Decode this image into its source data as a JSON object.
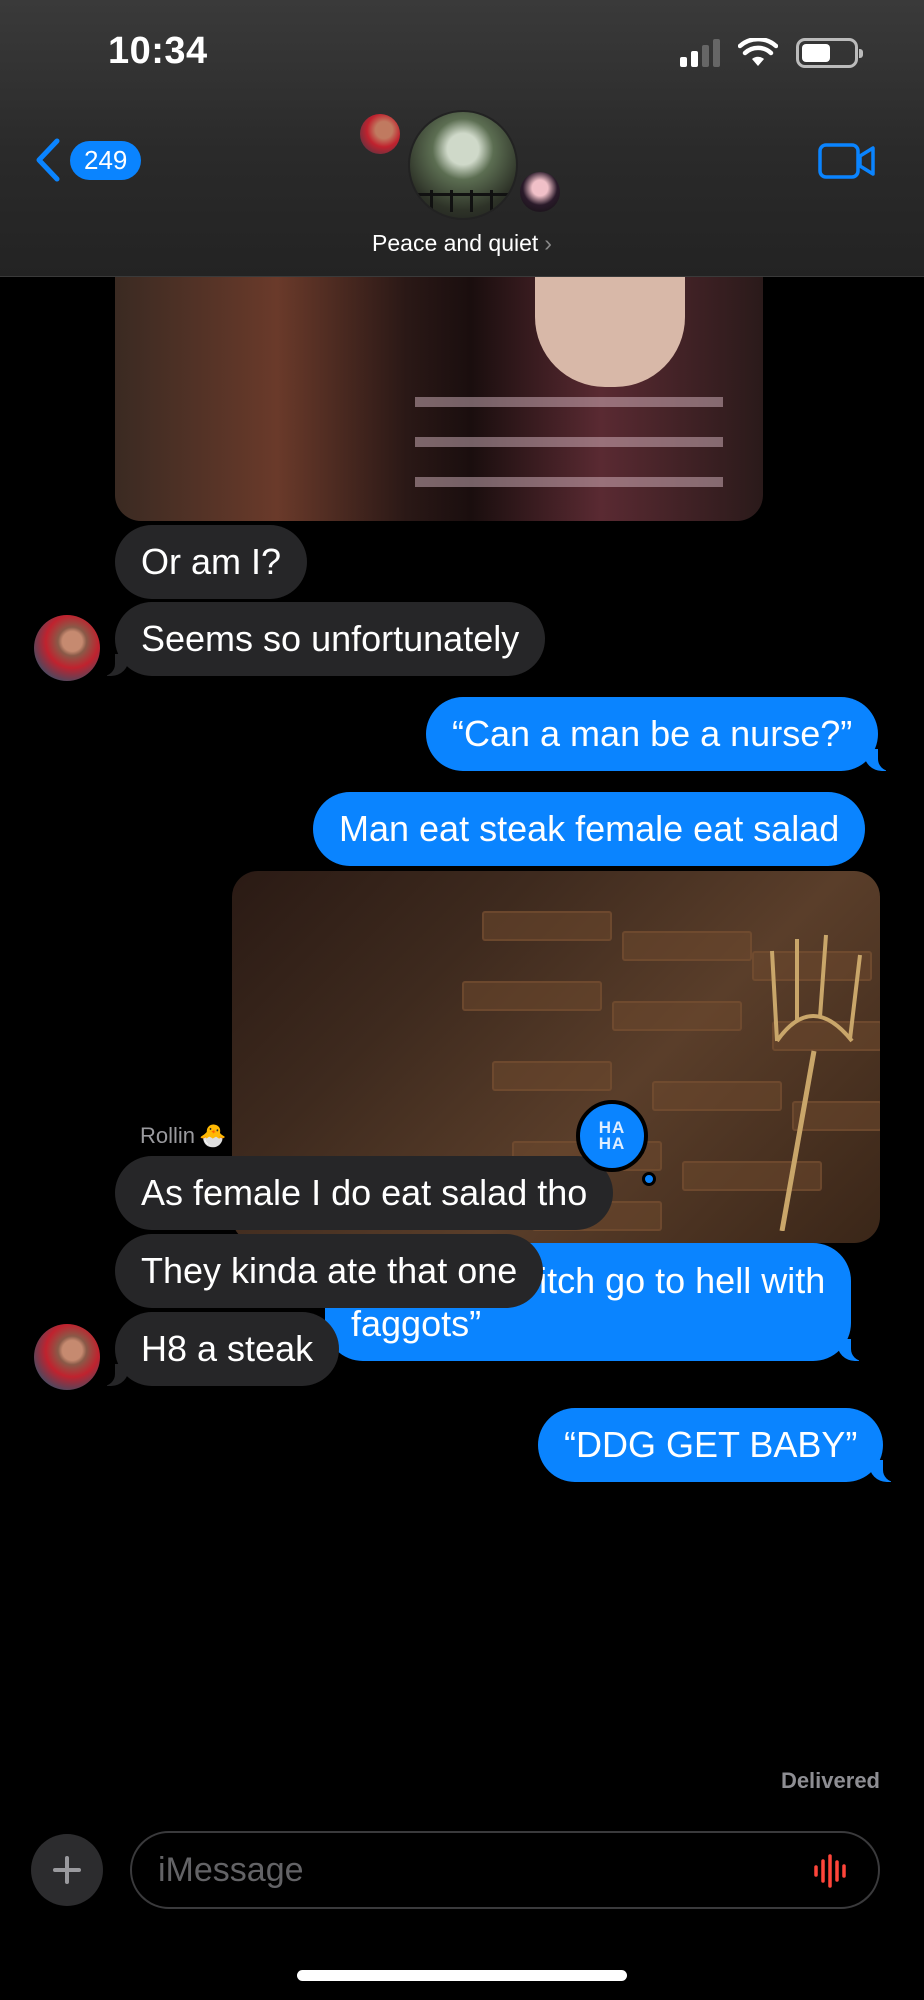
{
  "status_bar": {
    "time": "10:34"
  },
  "header": {
    "back_count": "249",
    "group_name": "Peace and quiet",
    "chevron": "›"
  },
  "messages": {
    "m1": "Or am I?",
    "m2": "Seems so unfortunately",
    "m3": "“Can a man be a nurse?”",
    "m4": "Man eat steak female eat salad",
    "m5a": "“Fat black bitch go to hell with",
    "m5b": "faggots”",
    "sender": "Rollin",
    "sender_emoji": "🐣",
    "m6": "As female I do eat salad tho",
    "m7": "They kinda ate that one",
    "m8": "H8 a steak",
    "m9": "“DDG GET BABY”",
    "delivered": "Delivered"
  },
  "tapback": {
    "top": "HA",
    "bottom": "HA"
  },
  "composer": {
    "placeholder": "iMessage"
  },
  "colors": {
    "accent": "#0a84ff",
    "incoming": "#262628",
    "background": "#000000"
  },
  "icons": [
    "chevron-left-icon",
    "video-camera-icon",
    "plus-icon",
    "audio-waveform-icon",
    "wifi-icon",
    "signal-icon",
    "battery-icon"
  ]
}
